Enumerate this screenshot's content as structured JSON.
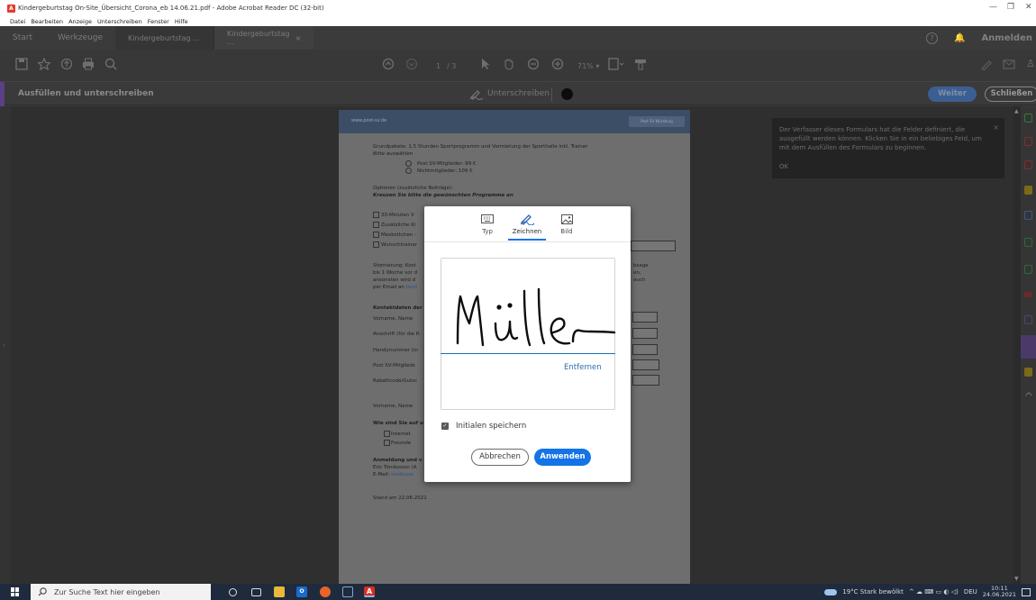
{
  "window": {
    "title": "Kindergeburtstag On-Site_Übersicht_Corona_eb 14.06.21.pdf - Adobe Acrobat Reader DC (32-bit)",
    "app_icon_glyph": "A",
    "minimize": "—",
    "maximize": "❐",
    "close": "✕"
  },
  "menu": [
    "Datei",
    "Bearbeiten",
    "Anzeige",
    "Unterschreiben",
    "Fenster",
    "Hilfe"
  ],
  "tabs": {
    "start": "Start",
    "tools": "Werkzeuge",
    "doc1": "Kindergeburtstag ...",
    "doc2": "Kindergeburtstag ...",
    "doc2_close": "×",
    "help": "?",
    "bell": "🔔",
    "signin": "Anmelden"
  },
  "toolbar": {
    "page_current": "1",
    "page_total": "/ 3",
    "zoom": "71%",
    "icons": [
      "save-icon",
      "bookmark-icon",
      "upload-icon",
      "print-icon",
      "search-icon",
      "page-up-icon",
      "page-down-icon",
      "select-icon",
      "hand-icon",
      "zoom-out-icon",
      "zoom-in-icon",
      "fit-icon",
      "markup-icon",
      "sign-icon",
      "mail-icon"
    ]
  },
  "fillbar": {
    "title": "Ausfüllen und unterschreiben",
    "sign_label": "Unterschreiben",
    "next": "Weiter",
    "close": "Schließen",
    "accent_color": "#5c3f86"
  },
  "document": {
    "url": "www.post-sv.de",
    "logo": "Post SV Würzburg",
    "lines": {
      "grundpakete_head": "Grundpakete:",
      "grundpakete_text": " 1,5 Stunden Sportprogramm und Vermietung der Sporthalle inkl. Trainer",
      "bitte": "Bitte auswählen",
      "opt1": "Post SV-Mitglieder: 99 €",
      "opt2": "Nichtmitglieder: 109 €",
      "optionen_head": "Optionen",
      "optionen_text": " (zusätzliche Beiträge):",
      "kreuzen": "Kreuzen Sie bitte die gewünschten Programme an",
      "c1": "30-Minuten V",
      "c2": "Zusätzliche Ki",
      "c3": "Mexkottchen -",
      "c4": "Wunschtrainer",
      "storno_head": "Stornierung:",
      "storno_text": " Kost",
      "storno2": "bis 1 Woche vor d",
      "storno3": "ansonsten wird d",
      "storno4": "per Email an ",
      "storno4_link": "tond",
      "storno_r1": "bsage",
      "storno_r2": "en,",
      "storno_r3": "auch",
      "kontakt_head": "Kontaktdaten der",
      "k1": "Vorname, Name",
      "k2": "Anschrift (für die R",
      "k3": "Handynummer (in",
      "k4": "Post SV-Mitglieds",
      "k5": "Rabattcode/Gutsc",
      "k6": "Vorname, Name",
      "wie_head": "Wie sind Sie auf u",
      "w1": "Internet",
      "w2": "Freunde",
      "anm_head": "Anmeldung und v",
      "anm1": "Eric Tondusson (A",
      "anm2": "E-Mail: ",
      "anm2_link": "tondusso",
      "stand": "Stand am 22.06.2021"
    }
  },
  "notice": {
    "text": "Der Verfasser dieses Formulars hat die Felder definiert, die ausgefüllt werden können. Klicken Sie in ein beliebiges Feld, um mit dem Ausfüllen des Formulars zu beginnen.",
    "ok": "OK",
    "close": "×"
  },
  "dialog": {
    "tabs": [
      {
        "label": "Typ",
        "icon": "keyboard-icon"
      },
      {
        "label": "Zeichnen",
        "icon": "draw-pen-icon"
      },
      {
        "label": "Bild",
        "icon": "image-icon"
      }
    ],
    "active_tab": "Zeichnen",
    "remove": "Entfernen",
    "save_initials": "Initialen speichern",
    "save_initials_checked": true,
    "cancel": "Abbrechen",
    "apply": "Anwenden",
    "accent_color": "#1473e6"
  },
  "taskbar": {
    "search_placeholder": "Zur Suche Text hier eingeben",
    "weather": "19°C  Stark bewölkt",
    "tray_icons": "^ ☁ ⌨ ▭ ◐ ◁)",
    "language": "DEU",
    "time": "10:11",
    "date": "24.06.2021"
  }
}
